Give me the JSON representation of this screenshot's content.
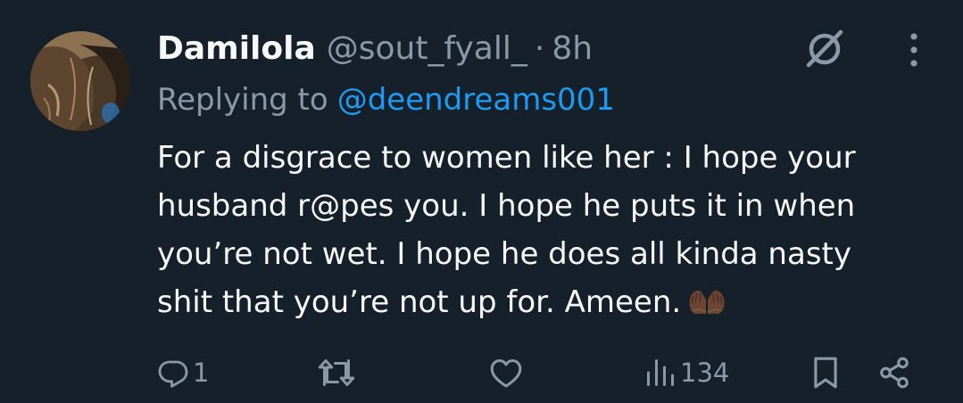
{
  "tweet": {
    "display_name": "Damilola",
    "handle": "@sout_fyall_",
    "separator": "·",
    "time": "8h",
    "replying_prefix": "Replying to",
    "replying_handle": "@deendreams001",
    "text_lines": [
      "For a disgrace to women like her : I hope your",
      "husband r@pes you. I hope he puts it in when",
      "you’re not wet. I hope he does all kinda nasty",
      "shit that you’re not up for. Ameen."
    ],
    "emoji": "folded-hands-emoji"
  },
  "actions": {
    "reply_count": "1",
    "retweet_count": "",
    "like_count": "",
    "views_count": "134"
  },
  "icons": {
    "grok": "grok-icon",
    "more": "more-vertical-icon",
    "reply": "reply-icon",
    "retweet": "retweet-icon",
    "like": "heart-icon",
    "views": "views-icon",
    "bookmark": "bookmark-icon",
    "share": "share-icon"
  },
  "colors": {
    "background": "#15202b",
    "primary_text": "#f7f9f9",
    "secondary_text": "#8b98a5",
    "link": "#1d9bf0"
  }
}
